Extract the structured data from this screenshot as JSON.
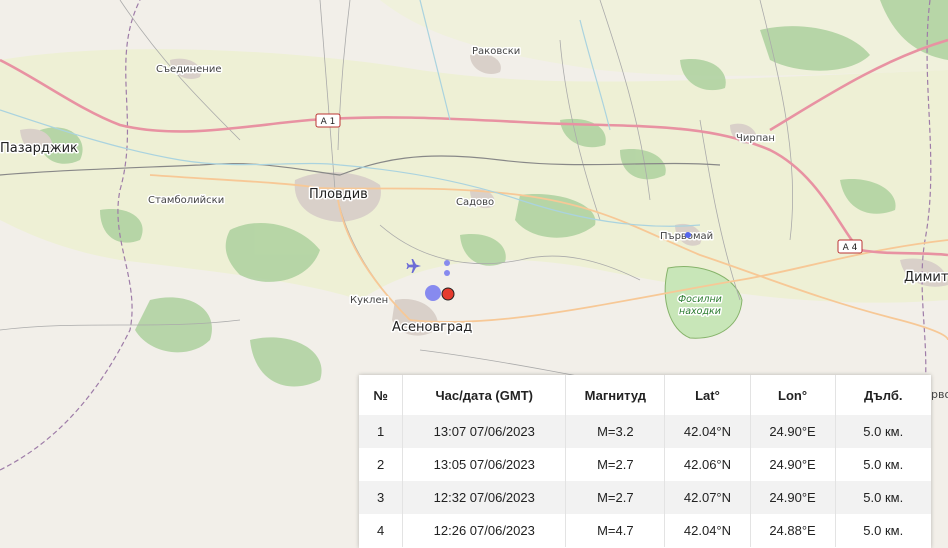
{
  "map": {
    "places": {
      "pazardzhik": "Пазарджик",
      "saedinenie": "Съединение",
      "rakovski": "Раковски",
      "plovdiv": "Пловдив",
      "stamboliyski": "Стамболийски",
      "sadovo": "Садово",
      "chirpan": "Чирпан",
      "parvomay": "Първомай",
      "kuklen": "Куклен",
      "asenovgrad": "Асеновград",
      "dimitrovgrad_partial": "Димит",
      "fossil_line1": "Фосилни",
      "fossil_line2": "находки",
      "edge_partial": "рво"
    },
    "roads": {
      "a1": "A 1",
      "a4": "A 4"
    },
    "colors": {
      "land": "#f2efe9",
      "farmland": "#eef0d5",
      "forest": "#add19e",
      "motorway": "#e892a2",
      "trunk": "#f9b29c",
      "primary": "#fcd6a4",
      "urban": "#d9d0c9",
      "boundary": "#9e7ca8",
      "quake_recent": "#e63b2e",
      "quake_old": "#7b7ef0"
    }
  },
  "quake_table": {
    "headers": {
      "no": "№",
      "time": "Час/дата (GMT)",
      "mag": "Магнитуд",
      "lat": "Lat°",
      "lon": "Lon°",
      "depth": "Дълб."
    },
    "rows": [
      {
        "no": "1",
        "time": "13:07 07/06/2023",
        "mag": "M=3.2",
        "lat": "42.04°N",
        "lon": "24.90°E",
        "depth": "5.0 км."
      },
      {
        "no": "2",
        "time": "13:05 07/06/2023",
        "mag": "M=2.7",
        "lat": "42.06°N",
        "lon": "24.90°E",
        "depth": "5.0 км."
      },
      {
        "no": "3",
        "time": "12:32 07/06/2023",
        "mag": "M=2.7",
        "lat": "42.07°N",
        "lon": "24.90°E",
        "depth": "5.0 км."
      },
      {
        "no": "4",
        "time": "12:26 07/06/2023",
        "mag": "M=4.7",
        "lat": "42.04°N",
        "lon": "24.88°E",
        "depth": "5.0 км."
      }
    ]
  }
}
